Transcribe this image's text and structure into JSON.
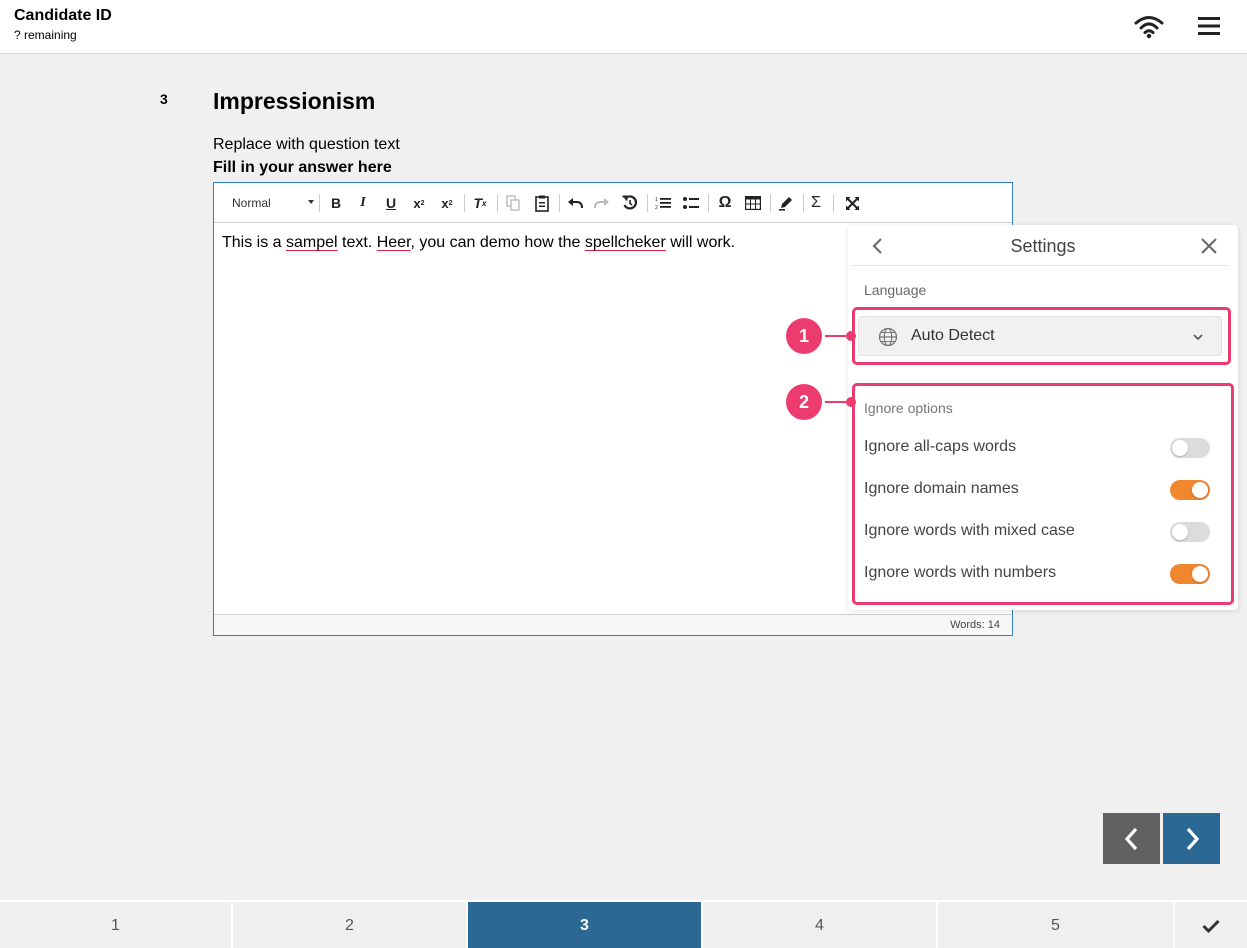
{
  "header": {
    "title": "Candidate ID",
    "subtitle": "? remaining",
    "wifi_icon": "wifi-icon",
    "menu_icon": "hamburger-menu-icon"
  },
  "question": {
    "number": "3",
    "title": "Impressionism",
    "text": "Replace with question text",
    "instruction": "Fill in your answer here"
  },
  "editor": {
    "format_label": "Normal",
    "content": {
      "t1": "This is a ",
      "w1": "sampel",
      "t2": " text. ",
      "w2": "Heer",
      "t3": ", you can demo how the ",
      "w3": "spellcheker",
      "t4": " will work."
    },
    "word_count": "Words: 14"
  },
  "settings": {
    "title": "Settings",
    "language_label": "Language",
    "language_value": "Auto Detect",
    "ignore_heading": "Ignore options",
    "options": [
      {
        "label": "Ignore all-caps words",
        "enabled": false
      },
      {
        "label": "Ignore domain names",
        "enabled": true
      },
      {
        "label": "Ignore words with mixed case",
        "enabled": false
      },
      {
        "label": "Ignore words with numbers",
        "enabled": true
      }
    ],
    "accent_color": "#f0862d"
  },
  "callouts": {
    "one": "1",
    "two": "2",
    "color": "#ec3b6f"
  },
  "pager": {
    "pages": [
      "1",
      "2",
      "3",
      "4",
      "5"
    ],
    "active": "3",
    "active_color": "#2c6894"
  }
}
